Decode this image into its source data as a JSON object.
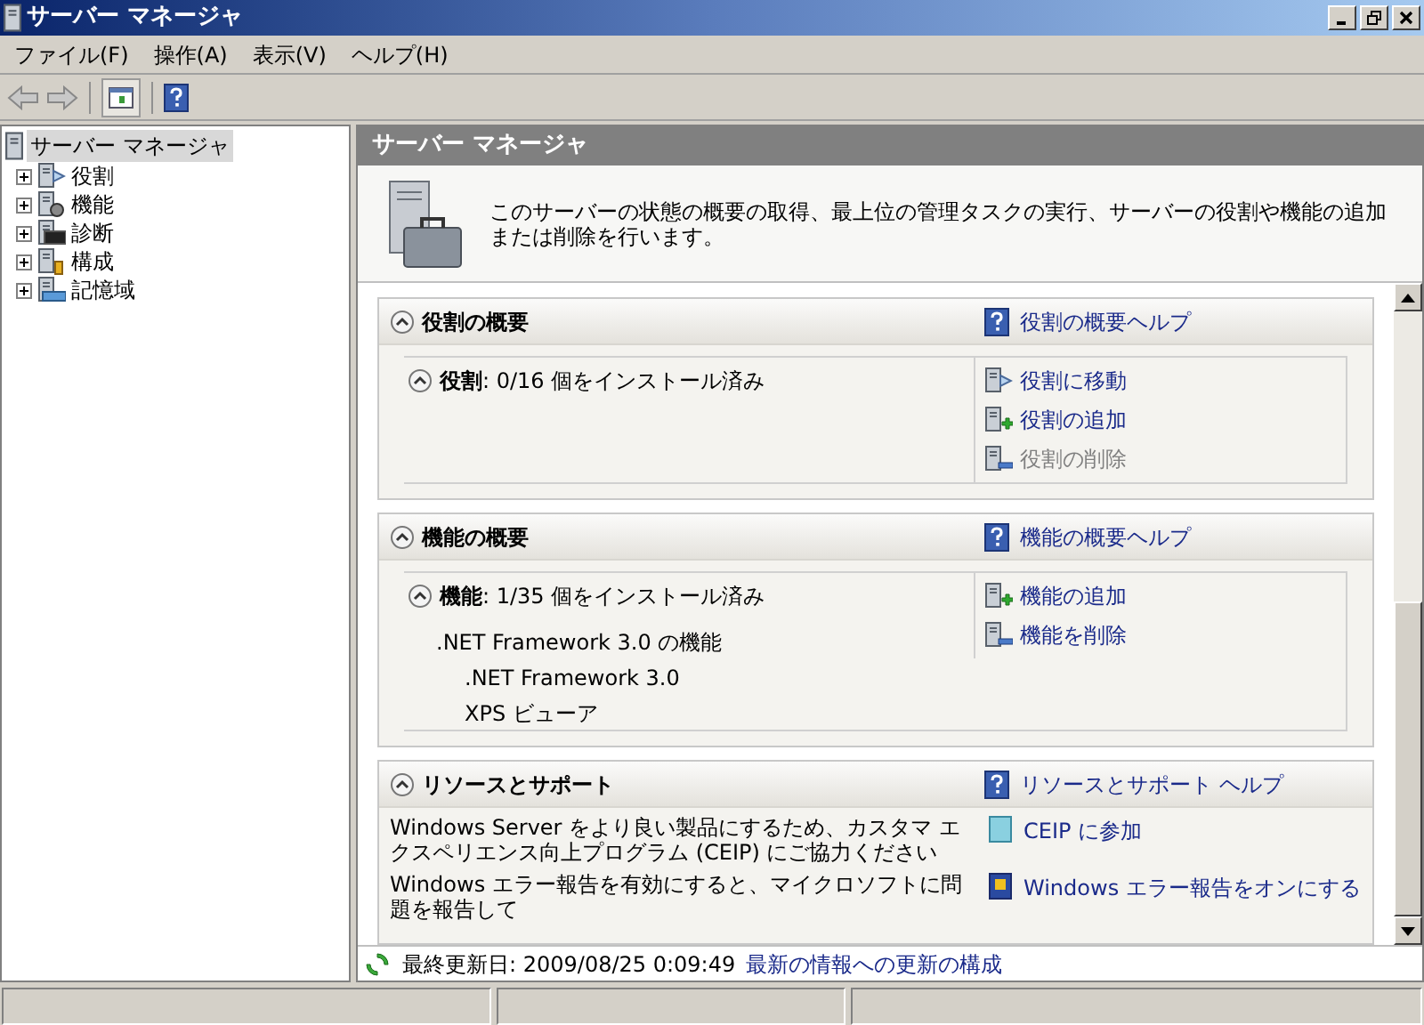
{
  "window": {
    "title": "サーバー マネージャ"
  },
  "menu": [
    "ファイル(F)",
    "操作(A)",
    "表示(V)",
    "ヘルプ(H)"
  ],
  "tree": {
    "root": {
      "label": "サーバー マネージャ",
      "selected": true
    },
    "items": [
      {
        "label": "役割",
        "expanded": false,
        "kind": "roles"
      },
      {
        "label": "機能",
        "expanded": false,
        "kind": "features"
      },
      {
        "label": "診断",
        "expanded": false,
        "kind": "diagnostics"
      },
      {
        "label": "構成",
        "expanded": false,
        "kind": "config"
      },
      {
        "label": "記憶域",
        "expanded": false,
        "kind": "storage"
      }
    ]
  },
  "content_header": "サーバー マネージャ",
  "description": "このサーバーの状態の概要の取得、最上位の管理タスクの実行、サーバーの役割や機能の追加または削除を行います。",
  "sections": [
    {
      "kind": "summary",
      "title": "役割の概要",
      "help": "役割の概要ヘルプ",
      "expanded": true,
      "summary": {
        "text": "**役割**: 0/16 個をインストール済み",
        "expanded": true
      },
      "actions": [
        {
          "label": "役割に移動",
          "kind": "go",
          "disabled": false
        },
        {
          "label": "役割の追加",
          "kind": "add",
          "disabled": false
        },
        {
          "label": "役割の削除",
          "kind": "remove",
          "disabled": true
        }
      ]
    },
    {
      "kind": "summary",
      "title": "機能の概要",
      "help": "機能の概要ヘルプ",
      "expanded": true,
      "summary": {
        "text": "**機能**: 1/35 個をインストール済み",
        "expanded": true
      },
      "installed": [
        {
          "label": ".NET Framework 3.0 の機能",
          "children": [
            {
              "label": ".NET Framework 3.0"
            },
            {
              "label": "XPS ビューア"
            }
          ]
        }
      ],
      "actions": [
        {
          "label": "機能の追加",
          "kind": "add",
          "disabled": false
        },
        {
          "label": "機能を削除",
          "kind": "remove",
          "disabled": false
        }
      ]
    },
    {
      "kind": "resources",
      "title": "リソースとサポート",
      "help": "リソースとサポート ヘルプ",
      "expanded": true,
      "rows": [
        {
          "text": "Windows Server をより良い製品にするため、カスタマ エクスペリエンス向上プログラム (CEIP) にご協力ください",
          "link": "CEIP に参加",
          "kind": "ceip"
        },
        {
          "text": "Windows エラー報告を有効にすると、マイクロソフトに問題を報告して",
          "link": "Windows エラー報告をオンにする",
          "kind": "wer"
        }
      ]
    }
  ],
  "footer": {
    "label": "最終更新日: 2009/08/25 0:09:49",
    "link": "最新の情報への更新の構成"
  }
}
